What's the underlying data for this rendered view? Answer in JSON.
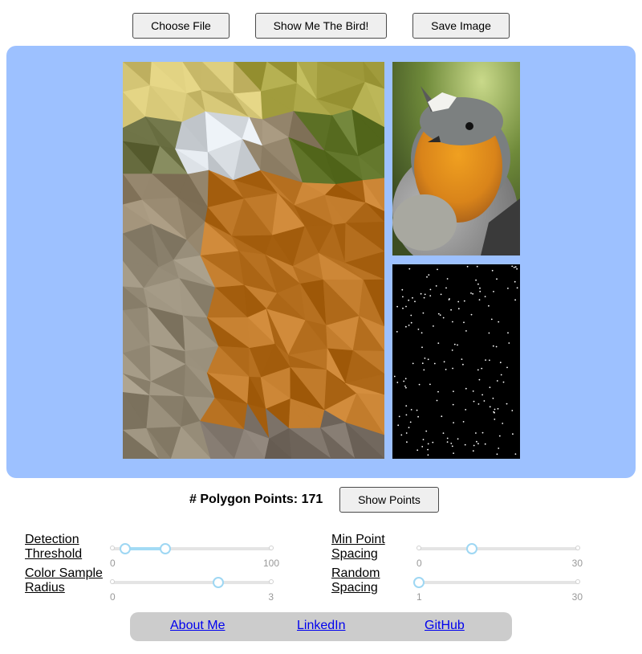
{
  "toolbar": {
    "choose_file_label": "Choose File",
    "show_bird_label": "Show Me The Bird!",
    "save_image_label": "Save Image"
  },
  "panel": {
    "background": "#9dc1ff"
  },
  "stats": {
    "polygon_points_label": "# Polygon Points: 171",
    "show_points_label": "Show Points"
  },
  "controls": {
    "detection_threshold": {
      "label_line1": "Detection",
      "label_line2": "Threshold",
      "min": "0",
      "max": "100",
      "range_low": 10,
      "range_high": 42
    },
    "color_sample_radius": {
      "label_line1": "Color Sample",
      "label_line2": "Radius",
      "min": "0",
      "max": "3",
      "value": 2
    },
    "min_point_spacing": {
      "label_line1": "Min Point",
      "label_line2": "Spacing",
      "min": "0",
      "max": "30",
      "value": 10
    },
    "random_spacing": {
      "label_line1": "Random",
      "label_line2": "Spacing",
      "min": "1",
      "max": "30",
      "value": 1
    }
  },
  "footer": {
    "about_label": "About Me",
    "linkedin_label": "LinkedIn",
    "github_label": "GitHub"
  }
}
